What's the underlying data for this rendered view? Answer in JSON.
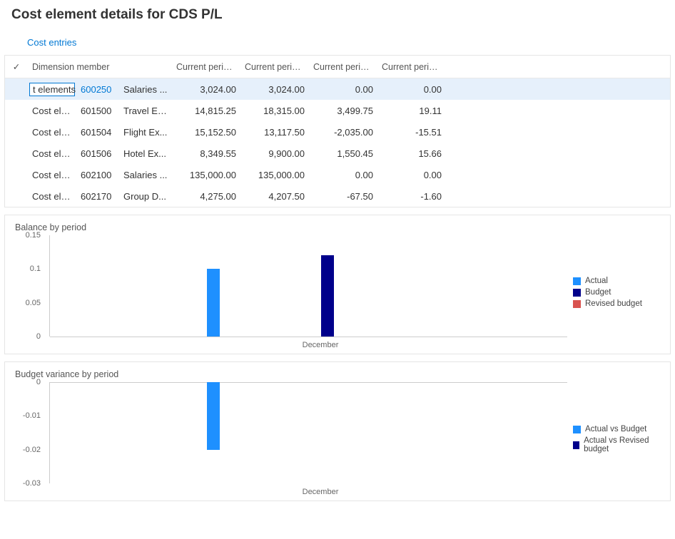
{
  "page_title": "Cost element details for CDS P/L",
  "link_cost_entries": "Cost entries",
  "table": {
    "check_glyph": "✓",
    "headers": {
      "dimension": "Dimension member",
      "col1": "Current period ...",
      "col2": "Current period ...",
      "col3": "Current period ...",
      "col4": "Current period ..."
    },
    "rows": [
      {
        "selected": true,
        "dim_edit": "t elements",
        "code": "600250",
        "desc": "Salaries ...",
        "c1": "3,024.00",
        "c2": "3,024.00",
        "c3": "0.00",
        "c4": "0.00"
      },
      {
        "selected": false,
        "dim": "Cost ele...",
        "code": "601500",
        "desc": "Travel Ex...",
        "c1": "14,815.25",
        "c2": "18,315.00",
        "c3": "3,499.75",
        "c4": "19.11"
      },
      {
        "selected": false,
        "dim": "Cost ele...",
        "code": "601504",
        "desc": "Flight Ex...",
        "c1": "15,152.50",
        "c2": "13,117.50",
        "c3": "-2,035.00",
        "c4": "-15.51"
      },
      {
        "selected": false,
        "dim": "Cost ele...",
        "code": "601506",
        "desc": "Hotel Ex...",
        "c1": "8,349.55",
        "c2": "9,900.00",
        "c3": "1,550.45",
        "c4": "15.66"
      },
      {
        "selected": false,
        "dim": "Cost ele...",
        "code": "602100",
        "desc": "Salaries ...",
        "c1": "135,000.00",
        "c2": "135,000.00",
        "c3": "0.00",
        "c4": "0.00"
      },
      {
        "selected": false,
        "dim": "Cost ele...",
        "code": "602170",
        "desc": "Group D...",
        "c1": "4,275.00",
        "c2": "4,207.50",
        "c3": "-67.50",
        "c4": "-1.60"
      }
    ]
  },
  "colors": {
    "actual": "#1e90ff",
    "budget": "#00008b",
    "revised": "#d9534f"
  },
  "chart_data": [
    {
      "type": "bar",
      "title": "Balance by period",
      "categories": [
        "December"
      ],
      "series": [
        {
          "name": "Actual",
          "values": [
            0.1
          ]
        },
        {
          "name": "Budget",
          "values": [
            0.12
          ]
        },
        {
          "name": "Revised budget",
          "values": [
            0.0
          ]
        }
      ],
      "ylim": [
        0,
        0.15
      ],
      "yticks": [
        0,
        0.05,
        0.1,
        0.15
      ],
      "ytick_labels": [
        "0",
        "0.05",
        "0.1",
        "0.15"
      ]
    },
    {
      "type": "bar",
      "title": "Budget variance by period",
      "categories": [
        "December"
      ],
      "series": [
        {
          "name": "Actual vs Budget",
          "values": [
            -0.02
          ]
        },
        {
          "name": "Actual vs Revised budget",
          "values": [
            0.0
          ]
        }
      ],
      "ylim": [
        -0.03,
        0
      ],
      "yticks": [
        -0.03,
        -0.02,
        -0.01,
        0
      ],
      "ytick_labels": [
        "-0.03",
        "-0.02",
        "-0.01",
        "0"
      ]
    }
  ]
}
